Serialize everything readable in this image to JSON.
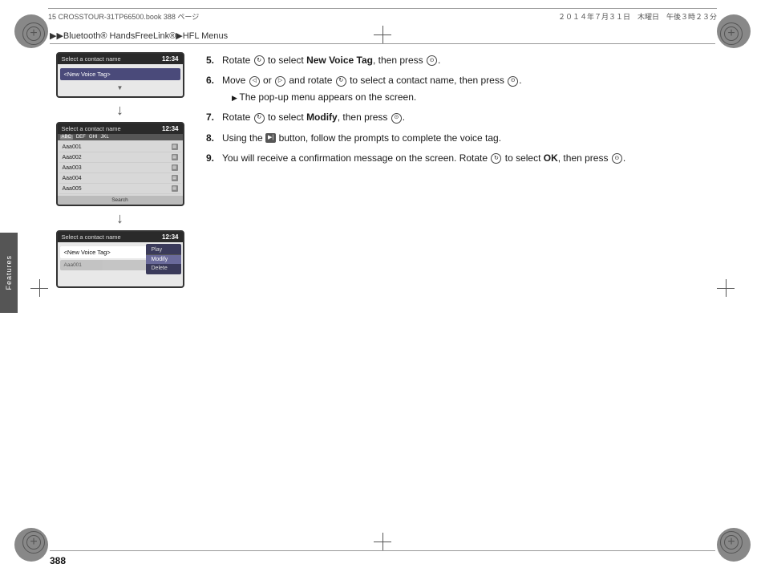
{
  "print_header": {
    "left": "15 CROSSTOUR-31TP66500.book   388 ページ",
    "right": "２０１４年７月３１日　木曜日　午後３時２３分"
  },
  "breadcrumb": {
    "text": "▶▶Bluetooth® HandsFreeLink®▶HFL Menus"
  },
  "side_tab": "Features",
  "screens": [
    {
      "id": "screen1",
      "header_title": "Select a contact name",
      "header_time": "12:34",
      "item": "<New Voice Tag>"
    },
    {
      "id": "screen2",
      "header_title": "Select a contact name",
      "header_time": "12:34",
      "alpha_tabs": [
        "ABC",
        "DEF",
        "GHI",
        "JKL"
      ],
      "contacts": [
        "Aaa001",
        "Aaa002",
        "Aaa003",
        "Aaa004",
        "Aaa005"
      ],
      "search_label": "Search"
    },
    {
      "id": "screen3",
      "header_title": "Select a contact name",
      "header_time": "12:34",
      "main_item": "<New Voice Tag>",
      "popup_items": [
        "Play",
        "Modify"
      ]
    }
  ],
  "steps": [
    {
      "num": "5.",
      "text": "Rotate {rotate} to select ",
      "bold": "New Voice Tag",
      "text2": ", then press {press}."
    },
    {
      "num": "6.",
      "text": "Move {left} or {right} and rotate {rotate} to select a contact name, then press {press}.",
      "sub": "The pop-up menu appears on the screen."
    },
    {
      "num": "7.",
      "text": "Rotate {rotate} to select ",
      "bold": "Modify",
      "text2": ", then press {press}."
    },
    {
      "num": "8.",
      "text": "Using the {btn} button, follow the prompts to complete the voice tag."
    },
    {
      "num": "9.",
      "text": "You will receive a confirmation message on the screen. Rotate {rotate} to select ",
      "bold": "OK",
      "text2": ", then press {press}."
    }
  ],
  "page_number": "388"
}
